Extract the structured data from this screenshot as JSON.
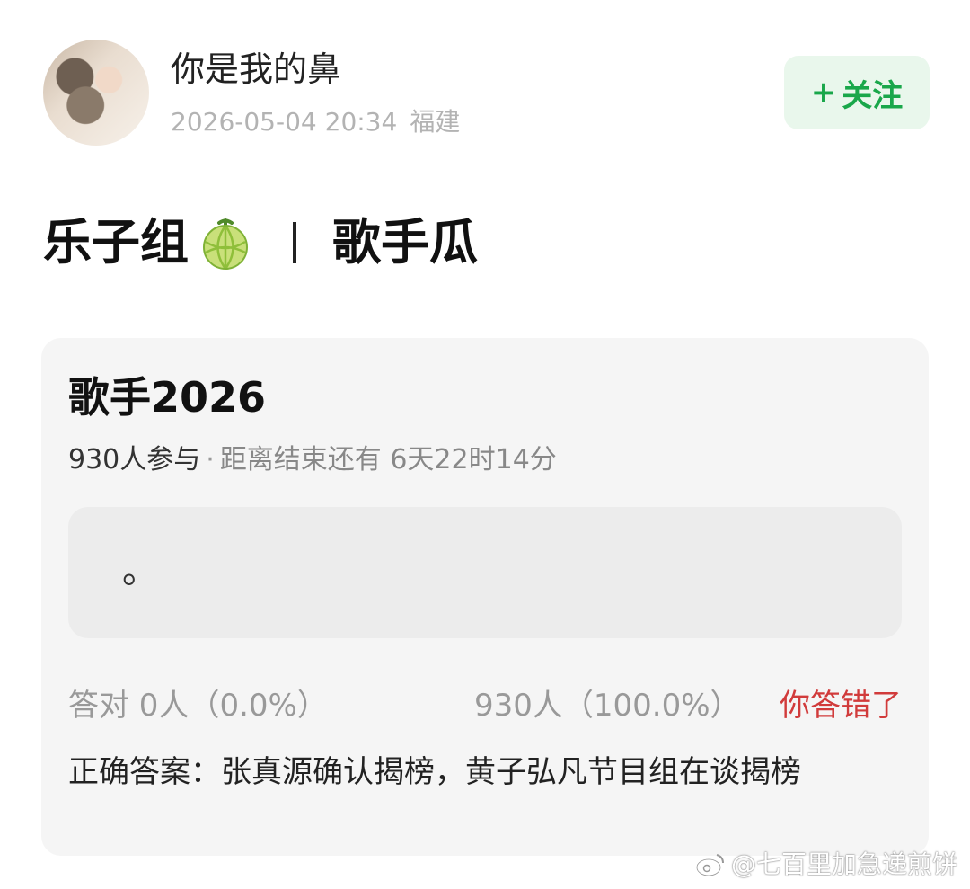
{
  "header": {
    "username": "你是我的鼻",
    "timestamp": "2026-05-04 20:34",
    "location": "福建",
    "follow_plus": "+",
    "follow_label": "关注"
  },
  "post": {
    "title_left": "乐子组",
    "title_icon": "melon-icon",
    "title_right": "歌手瓜"
  },
  "quiz": {
    "title": "歌手2026",
    "participants": "930人参与",
    "separator": "·",
    "countdown": "距离结束还有 6天22时14分",
    "option_text": "。",
    "correct_stat": "答对  0人（0.0%）",
    "wrong_stat": "930人（100.0%）",
    "verdict": "你答错了",
    "answer": "正确答案：张真源确认揭榜，黄子弘凡节目组在谈揭榜"
  },
  "watermark": {
    "text": "@七百里加急递煎饼",
    "icon": "weibo-icon"
  },
  "colors": {
    "follow_green": "#19a74a",
    "follow_bg": "#e9f7ec",
    "verdict_red": "#d13b3b",
    "card_bg": "#f5f5f5",
    "muted_text": "#b3b3b3"
  }
}
